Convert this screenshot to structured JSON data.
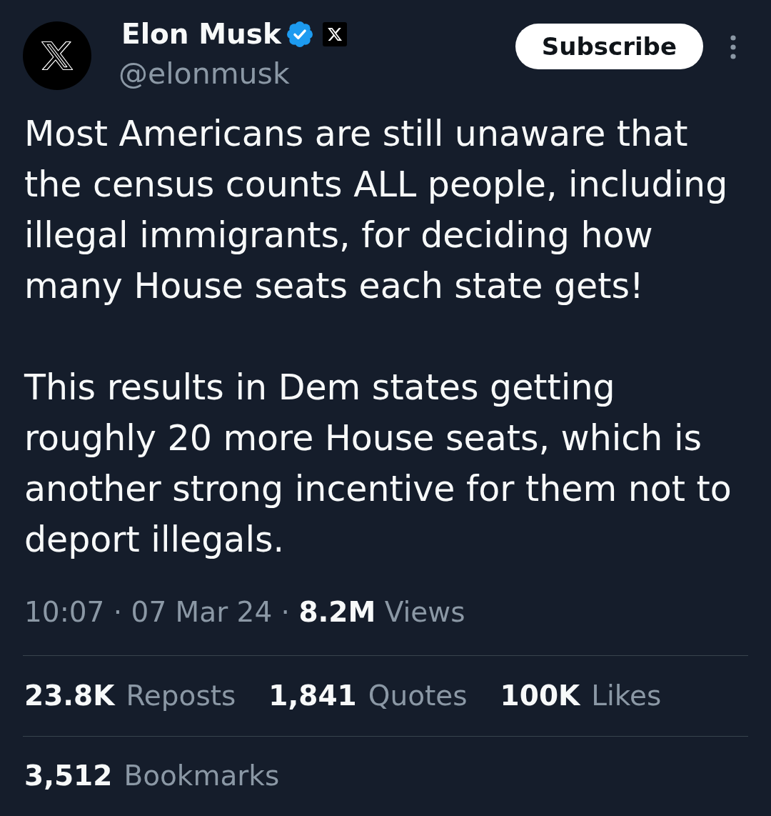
{
  "author": {
    "name": "Elon Musk",
    "verified": true,
    "affiliate_badge": true,
    "handle": "@elonmusk"
  },
  "subscribe_button": {
    "label": "Subscribe"
  },
  "post": {
    "paragraphs": [
      "Most Americans are still unaware that\nthe census counts ALL people, including\nillegal immigrants, for deciding how\nmany House seats each state gets!",
      "This results in Dem states getting\nroughly 20 more House seats, which is\nanother strong incentive for them not to\ndeport illegals."
    ]
  },
  "meta": "10:07 · 07 Mar 24 · **8.2M** Views",
  "stats": [
    {
      "count": "23.8K",
      "label": "Reposts"
    },
    {
      "count": "1,841",
      "label": "Quotes"
    },
    {
      "count": "100K",
      "label": "Likes"
    }
  ],
  "bookmarks": {
    "count": "3,512",
    "label": "Bookmarks"
  }
}
